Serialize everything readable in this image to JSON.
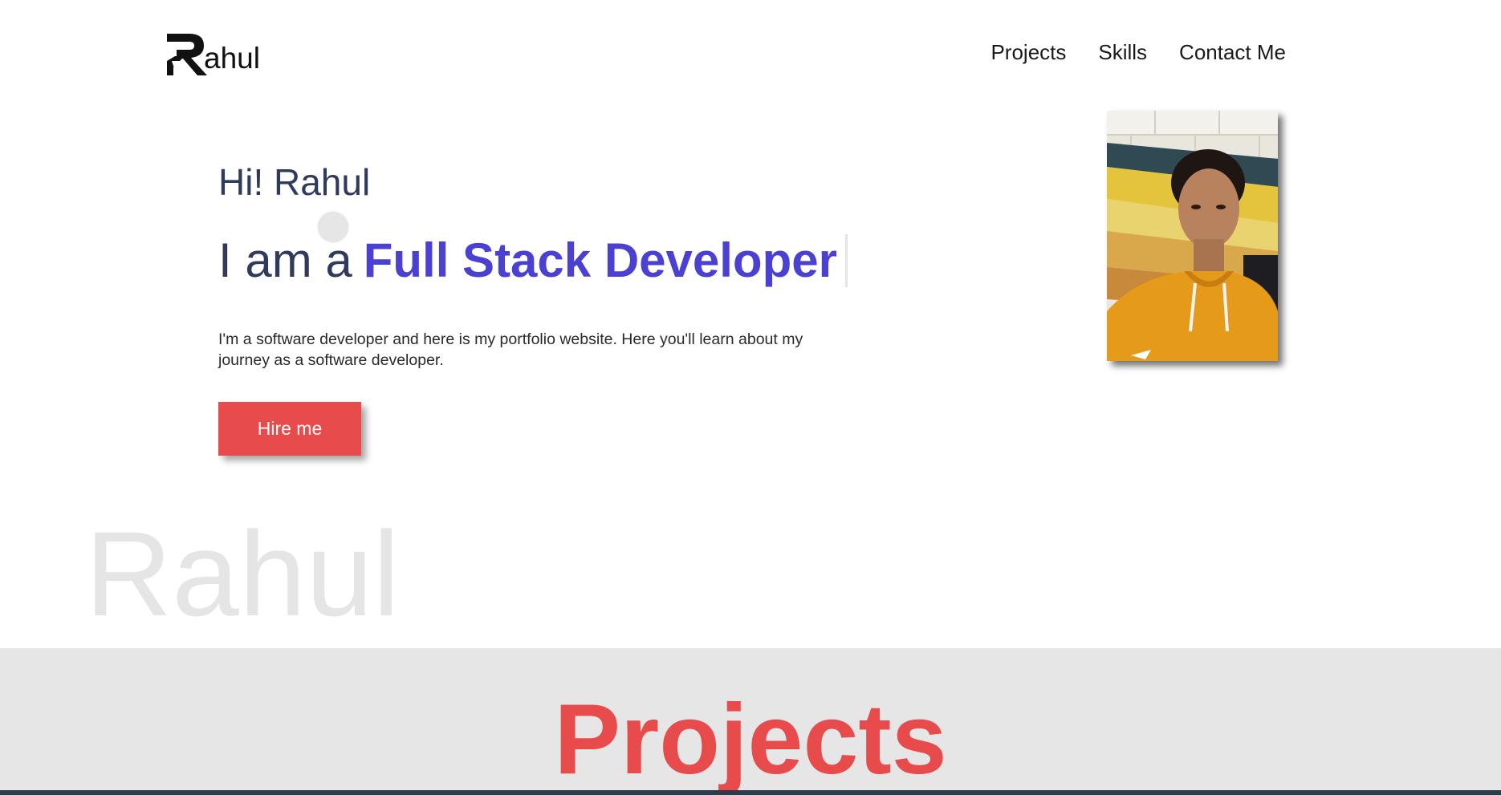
{
  "header": {
    "logo_text": "ahul",
    "logo_letter": "R",
    "nav": [
      {
        "label": "Projects"
      },
      {
        "label": "Skills"
      },
      {
        "label": "Contact Me"
      }
    ]
  },
  "hero": {
    "greeting": "Hi! Rahul",
    "headline_prefix": "I am a",
    "headline_role": "Full Stack Developer",
    "intro": "I'm a software developer and here is my portfolio website. Here you'll learn about my journey as a software developer.",
    "cta_label": "Hire me"
  },
  "watermark": "Rahul",
  "projects": {
    "title": "Projects"
  },
  "colors": {
    "accent_red": "#e84b4b",
    "accent_purple": "#4b40d4",
    "text_navy": "#2f3a5c",
    "band_gray": "#e6e6e6"
  },
  "icons": {
    "logo": "r-logo-icon",
    "profile": "profile-photo"
  }
}
